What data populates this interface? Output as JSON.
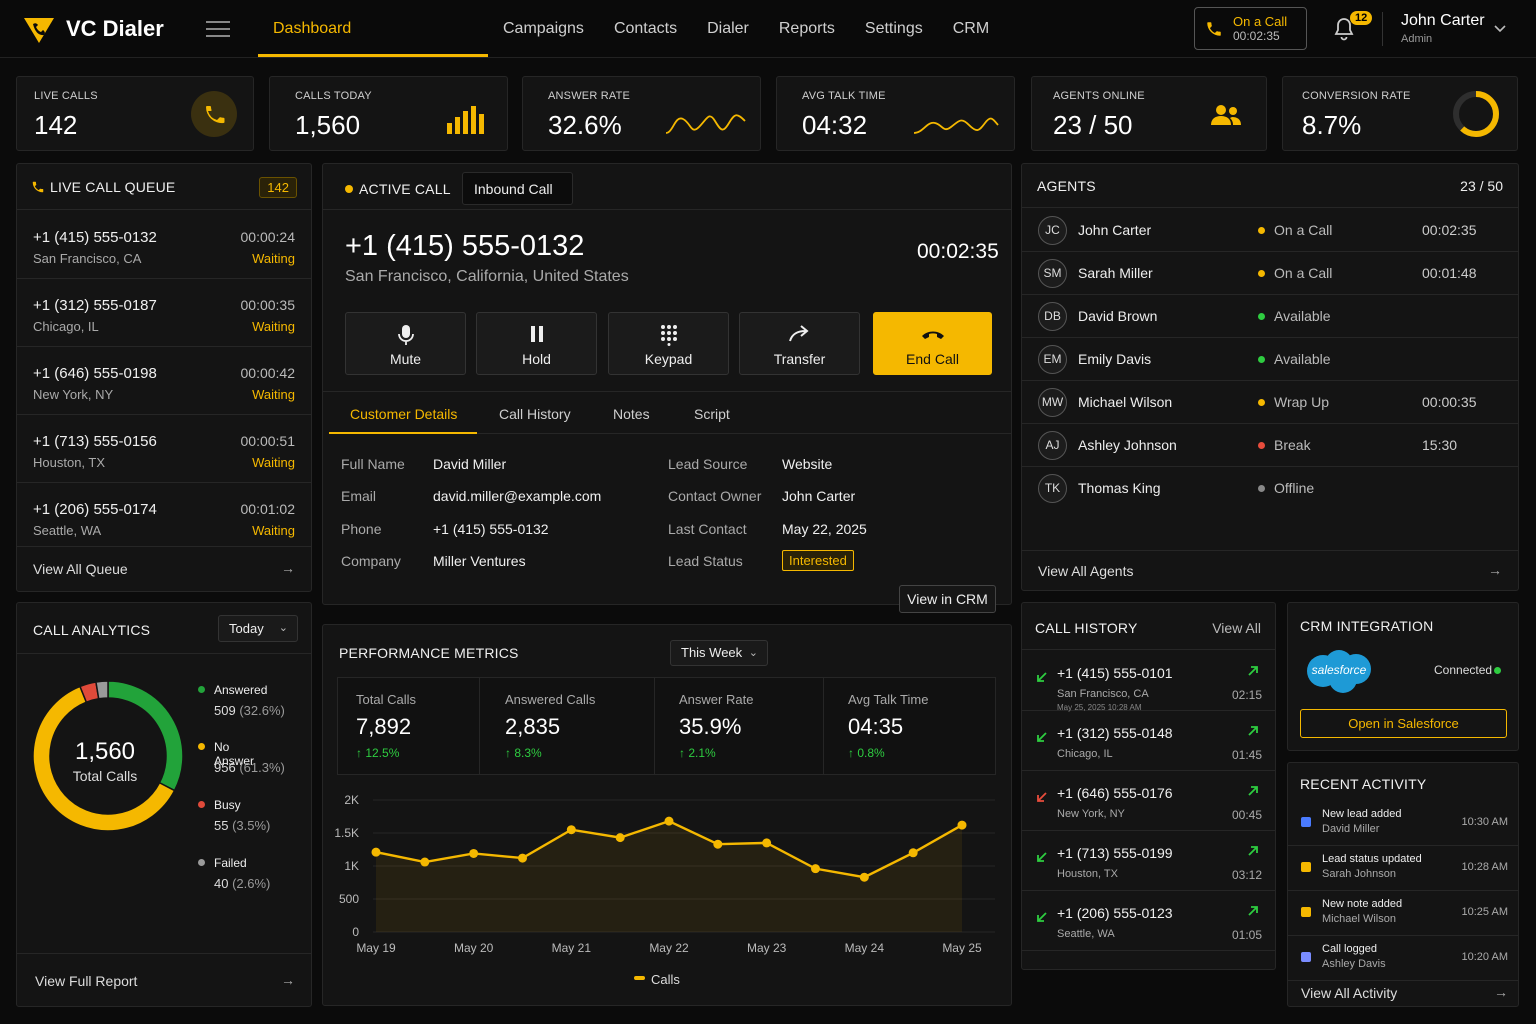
{
  "app": {
    "name": "VC Dialer"
  },
  "nav": [
    "Dashboard",
    "Campaigns",
    "Contacts",
    "Dialer",
    "Reports",
    "Settings",
    "CRM"
  ],
  "header": {
    "oncall_label": "On a Call",
    "oncall_time": "00:02:35",
    "notif_count": "12",
    "user_name": "John Carter",
    "user_role": "Admin"
  },
  "stats": [
    {
      "label": "LIVE CALLS",
      "value": "142"
    },
    {
      "label": "CALLS TODAY",
      "value": "1,560"
    },
    {
      "label": "ANSWER RATE",
      "value": "32.6%"
    },
    {
      "label": "AVG TALK TIME",
      "value": "04:32"
    },
    {
      "label": "AGENTS ONLINE",
      "value": "23 / 50"
    },
    {
      "label": "CONVERSION RATE",
      "value": "8.7%",
      "ring_fraction": 0.62
    }
  ],
  "queue": {
    "title": "LIVE CALL QUEUE",
    "count": "142",
    "footer": "View All Queue",
    "items": [
      {
        "phone": "+1 (415) 555-0132",
        "city": "San Francisco, CA",
        "time": "00:00:24",
        "status": "Waiting"
      },
      {
        "phone": "+1 (312) 555-0187",
        "city": "Chicago, IL",
        "time": "00:00:35",
        "status": "Waiting"
      },
      {
        "phone": "+1 (646) 555-0198",
        "city": "New York, NY",
        "time": "00:00:42",
        "status": "Waiting"
      },
      {
        "phone": "+1 (713) 555-0156",
        "city": "Houston, TX",
        "time": "00:00:51",
        "status": "Waiting"
      },
      {
        "phone": "+1 (206) 555-0174",
        "city": "Seattle, WA",
        "time": "00:01:02",
        "status": "Waiting"
      }
    ]
  },
  "active": {
    "label": "ACTIVE CALL",
    "type": "Inbound Call",
    "phone": "+1 (415) 555-0132",
    "location": "San Francisco, California, United States",
    "timer": "00:02:35",
    "buttons": [
      "Mute",
      "Hold",
      "Keypad",
      "Transfer",
      "End Call"
    ],
    "tabs": [
      "Customer Details",
      "Call History",
      "Notes",
      "Script"
    ],
    "details_left": [
      {
        "label": "Full Name",
        "value": "David Miller"
      },
      {
        "label": "Email",
        "value": "david.miller@example.com"
      },
      {
        "label": "Phone",
        "value": "+1 (415) 555-0132"
      },
      {
        "label": "Company",
        "value": "Miller Ventures"
      }
    ],
    "details_right": [
      {
        "label": "Lead Source",
        "value": "Website"
      },
      {
        "label": "Contact Owner",
        "value": "John Carter"
      },
      {
        "label": "Last Contact",
        "value": "May 22, 2025"
      },
      {
        "label": "Lead Status",
        "value": "Interested"
      }
    ],
    "view_crm": "View in CRM"
  },
  "agents": {
    "title": "AGENTS",
    "count": "23 / 50",
    "footer": "View All Agents",
    "items": [
      {
        "initials": "JC",
        "name": "John Carter",
        "status": "On a Call",
        "color": "#f5b800",
        "time": "00:02:35"
      },
      {
        "initials": "SM",
        "name": "Sarah Miller",
        "status": "On a Call",
        "color": "#f5b800",
        "time": "00:01:48"
      },
      {
        "initials": "DB",
        "name": "David Brown",
        "status": "Available",
        "color": "#2ecc40",
        "time": ""
      },
      {
        "initials": "EM",
        "name": "Emily Davis",
        "status": "Available",
        "color": "#2ecc40",
        "time": ""
      },
      {
        "initials": "MW",
        "name": "Michael Wilson",
        "status": "Wrap Up",
        "color": "#f5b800",
        "time": "00:00:35"
      },
      {
        "initials": "AJ",
        "name": "Ashley Johnson",
        "status": "Break",
        "color": "#e74c3c",
        "time": "15:30"
      },
      {
        "initials": "TK",
        "name": "Thomas King",
        "status": "Offline",
        "color": "#888888",
        "time": ""
      }
    ]
  },
  "analytics": {
    "title": "CALL ANALYTICS",
    "period": "Today",
    "total": "1,560",
    "total_label": "Total Calls",
    "footer": "View Full Report",
    "segments": [
      {
        "name": "Answered",
        "value": 509,
        "text": "509",
        "pct": "(32.6%)",
        "color": "#22a33a"
      },
      {
        "name": "No Answer",
        "value": 956,
        "text": "956",
        "pct": "(61.3%)",
        "color": "#f5b800"
      },
      {
        "name": "Busy",
        "value": 55,
        "text": "55",
        "pct": "(3.5%)",
        "color": "#e04a3a"
      },
      {
        "name": "Failed",
        "value": 40,
        "text": "40",
        "pct": "(2.6%)",
        "color": "#9a9a9a"
      }
    ]
  },
  "performance": {
    "title": "PERFORMANCE METRICS",
    "period": "This Week",
    "metrics": [
      {
        "label": "Total Calls",
        "value": "7,892",
        "change": "↑ 12.5%"
      },
      {
        "label": "Answered Calls",
        "value": "2,835",
        "change": "↑ 8.3%"
      },
      {
        "label": "Answer Rate",
        "value": "35.9%",
        "change": "↑ 2.1%"
      },
      {
        "label": "Avg Talk Time",
        "value": "04:35",
        "change": "↑ 0.8%"
      }
    ]
  },
  "chart_data": {
    "type": "line",
    "x": [
      0,
      1,
      2,
      3,
      4,
      5,
      6,
      7,
      8,
      9,
      10,
      11,
      12
    ],
    "x_ticks": [
      "May 19",
      "May 20",
      "May 21",
      "May 22",
      "May 23",
      "May 24",
      "May 25"
    ],
    "series": [
      {
        "name": "Calls",
        "values": [
          1210,
          1060,
          1190,
          1120,
          1550,
          1430,
          1680,
          1330,
          1350,
          960,
          830,
          1200,
          1620
        ]
      }
    ],
    "y_ticks": [
      "0",
      "500",
      "1K",
      "1.5K",
      "2K"
    ],
    "ylim": [
      0,
      2000
    ],
    "color": "#f5b800"
  },
  "history": {
    "title": "CALL HISTORY",
    "view_all": "View All",
    "items": [
      {
        "phone": "+1 (415) 555-0101",
        "city": "San Francisco, CA",
        "date": "May 25, 2025 10:28 AM",
        "dur": "02:15",
        "in_color": "#2ecc40"
      },
      {
        "phone": "+1 (312) 555-0148",
        "city": "Chicago, IL",
        "date": "",
        "dur": "01:45",
        "in_color": "#2ecc40"
      },
      {
        "phone": "+1 (646) 555-0176",
        "city": "New York, NY",
        "date": "",
        "dur": "00:45",
        "in_color": "#e74c3c"
      },
      {
        "phone": "+1 (713) 555-0199",
        "city": "Houston, TX",
        "date": "",
        "dur": "03:12",
        "in_color": "#2ecc40"
      },
      {
        "phone": "+1 (206) 555-0123",
        "city": "Seattle, WA",
        "date": "",
        "dur": "01:05",
        "in_color": "#2ecc40"
      }
    ]
  },
  "crm": {
    "title": "CRM INTEGRATION",
    "logo_text": "salesforce",
    "status": "Connected",
    "button": "Open in Salesforce"
  },
  "activity": {
    "title": "RECENT ACTIVITY",
    "footer": "View All Activity",
    "items": [
      {
        "title": "New lead added",
        "sub": "David Miller",
        "time": "10:30 AM",
        "color": "#4a7bff"
      },
      {
        "title": "Lead status updated",
        "sub": "Sarah Johnson",
        "time": "10:28 AM",
        "color": "#f5b800"
      },
      {
        "title": "New note added",
        "sub": "Michael Wilson",
        "time": "10:25 AM",
        "color": "#f5b800"
      },
      {
        "title": "Call logged",
        "sub": "Ashley Davis",
        "time": "10:20 AM",
        "color": "#7a8cff"
      }
    ]
  }
}
